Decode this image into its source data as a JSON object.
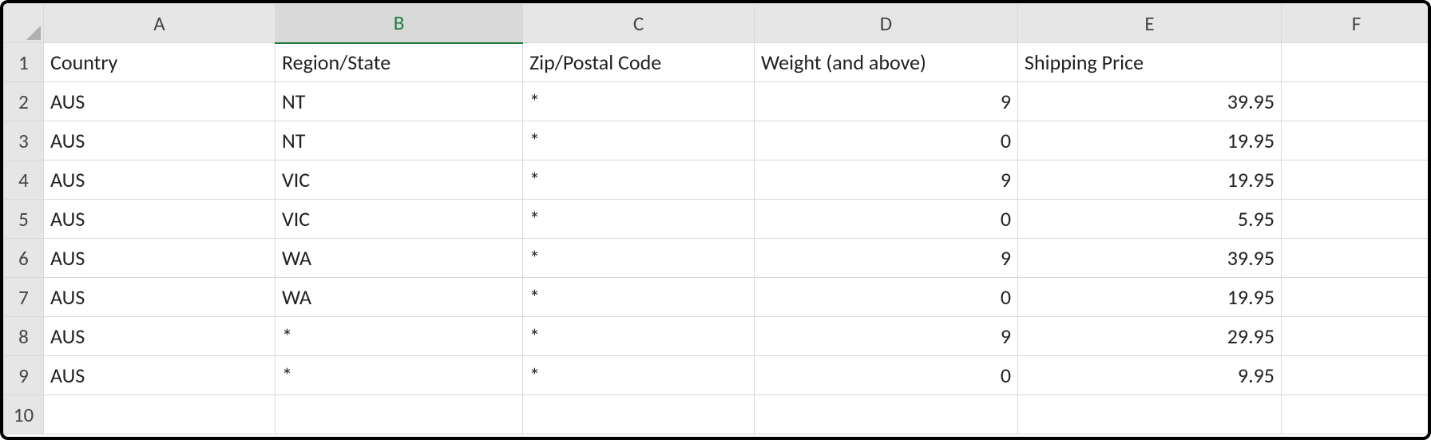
{
  "columns": [
    "A",
    "B",
    "C",
    "D",
    "E",
    "F"
  ],
  "selected_column_index": 1,
  "row_numbers": [
    1,
    2,
    3,
    4,
    5,
    6,
    7,
    8,
    9,
    10
  ],
  "numeric_columns": [
    3,
    4
  ],
  "rows": [
    {
      "cells": [
        "Country",
        "Region/State",
        "Zip/Postal Code",
        "Weight (and above)",
        "Shipping Price",
        ""
      ]
    },
    {
      "cells": [
        "AUS",
        "NT",
        "*",
        "9",
        "39.95",
        ""
      ]
    },
    {
      "cells": [
        "AUS",
        "NT",
        "*",
        "0",
        "19.95",
        ""
      ]
    },
    {
      "cells": [
        "AUS",
        "VIC",
        "*",
        "9",
        "19.95",
        ""
      ]
    },
    {
      "cells": [
        "AUS",
        "VIC",
        "*",
        "0",
        "5.95",
        ""
      ]
    },
    {
      "cells": [
        "AUS",
        "WA",
        "*",
        "9",
        "39.95",
        ""
      ]
    },
    {
      "cells": [
        "AUS",
        "WA",
        "*",
        "0",
        "19.95",
        ""
      ]
    },
    {
      "cells": [
        "AUS",
        "*",
        "*",
        "9",
        "29.95",
        ""
      ]
    },
    {
      "cells": [
        "AUS",
        "*",
        "*",
        "0",
        "9.95",
        ""
      ]
    },
    {
      "cells": [
        "",
        "",
        "",
        "",
        "",
        ""
      ]
    }
  ]
}
